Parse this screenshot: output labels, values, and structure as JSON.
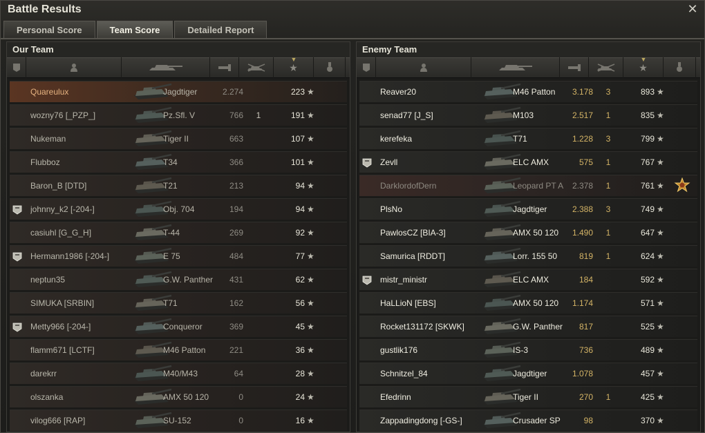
{
  "window": {
    "title": "Battle Results",
    "close_label": "✕"
  },
  "tabs": [
    {
      "label": "Personal Score",
      "active": false
    },
    {
      "label": "Team Score",
      "active": true
    },
    {
      "label": "Detailed Report",
      "active": false
    }
  ],
  "our_team": {
    "title": "Our Team",
    "rows": [
      {
        "name": "Quareulux",
        "tank": "Jagdtiger",
        "damage": "2.274",
        "frags": "",
        "xp": "223",
        "badge": false,
        "self": true
      },
      {
        "name": "wozny76 [_PZP_]",
        "tank": "Pz.Sfl. V",
        "damage": "766",
        "frags": "1",
        "xp": "191",
        "badge": false
      },
      {
        "name": "Nukeman",
        "tank": "Tiger II",
        "damage": "663",
        "frags": "",
        "xp": "107",
        "badge": false
      },
      {
        "name": "Flubboz",
        "tank": "T34",
        "damage": "366",
        "frags": "",
        "xp": "101",
        "badge": false
      },
      {
        "name": "Baron_B [DTD]",
        "tank": "T21",
        "damage": "213",
        "frags": "",
        "xp": "94",
        "badge": false
      },
      {
        "name": "johnny_k2 [-204-]",
        "tank": "Obj. 704",
        "damage": "194",
        "frags": "",
        "xp": "94",
        "badge": true
      },
      {
        "name": "casiuhl [G_G_H]",
        "tank": "T-44",
        "damage": "269",
        "frags": "",
        "xp": "92",
        "badge": false
      },
      {
        "name": "Hermann1986 [-204-]",
        "tank": "E 75",
        "damage": "484",
        "frags": "",
        "xp": "77",
        "badge": true
      },
      {
        "name": "neptun35",
        "tank": "G.W. Panther",
        "damage": "431",
        "frags": "",
        "xp": "62",
        "badge": false
      },
      {
        "name": "SIMUKA [SRBIN]",
        "tank": "T71",
        "damage": "162",
        "frags": "",
        "xp": "56",
        "badge": false
      },
      {
        "name": "Metty966 [-204-]",
        "tank": "Conqueror",
        "damage": "369",
        "frags": "",
        "xp": "45",
        "badge": true
      },
      {
        "name": "flamm671 [LCTF]",
        "tank": "M46 Patton",
        "damage": "221",
        "frags": "",
        "xp": "36",
        "badge": false
      },
      {
        "name": "darekrr",
        "tank": "M40/M43",
        "damage": "64",
        "frags": "",
        "xp": "28",
        "badge": false
      },
      {
        "name": "olszanka",
        "tank": "AMX 50 120",
        "damage": "0",
        "frags": "",
        "xp": "24",
        "badge": false
      },
      {
        "name": "vilog666 [RAP]",
        "tank": "SU-152",
        "damage": "0",
        "frags": "",
        "xp": "16",
        "badge": false
      }
    ]
  },
  "enemy_team": {
    "title": "Enemy Team",
    "rows": [
      {
        "name": "Reaver20",
        "tank": "M46 Patton",
        "damage": "3.178",
        "frags": "3",
        "xp": "893",
        "badge": false
      },
      {
        "name": "senad77 [J_S]",
        "tank": "M103",
        "damage": "2.517",
        "frags": "1",
        "xp": "835",
        "badge": false
      },
      {
        "name": "kerefeka",
        "tank": "T71",
        "damage": "1.228",
        "frags": "3",
        "xp": "799",
        "badge": false
      },
      {
        "name": "Zevll",
        "tank": "ELC AMX",
        "damage": "575",
        "frags": "1",
        "xp": "767",
        "badge": true
      },
      {
        "name": "DarklordofDern",
        "tank": "Leopard PT A",
        "damage": "2.378",
        "frags": "1",
        "xp": "761",
        "badge": false,
        "dead": true,
        "medal": true
      },
      {
        "name": "PlsNo",
        "tank": "Jagdtiger",
        "damage": "2.388",
        "frags": "3",
        "xp": "749",
        "badge": false
      },
      {
        "name": "PawlosCZ [BIA-3]",
        "tank": "AMX 50 120",
        "damage": "1.490",
        "frags": "1",
        "xp": "647",
        "badge": false
      },
      {
        "name": "Samurica [RDDT]",
        "tank": "Lorr. 155 50",
        "damage": "819",
        "frags": "1",
        "xp": "624",
        "badge": false
      },
      {
        "name": "mistr_ministr",
        "tank": "ELC AMX",
        "damage": "184",
        "frags": "",
        "xp": "592",
        "badge": true
      },
      {
        "name": "HaLLioN [EBS]",
        "tank": "AMX 50 120",
        "damage": "1.174",
        "frags": "",
        "xp": "571",
        "badge": false
      },
      {
        "name": "Rocket131172 [SKWK]",
        "tank": "G.W. Panther",
        "damage": "817",
        "frags": "",
        "xp": "525",
        "badge": false
      },
      {
        "name": "gustlik176",
        "tank": "IS-3",
        "damage": "736",
        "frags": "",
        "xp": "489",
        "badge": false
      },
      {
        "name": "Schnitzel_84",
        "tank": "Jagdtiger",
        "damage": "1.078",
        "frags": "",
        "xp": "457",
        "badge": false
      },
      {
        "name": "Efedrinn",
        "tank": "Tiger II",
        "damage": "270",
        "frags": "1",
        "xp": "425",
        "badge": false
      },
      {
        "name": "Zappadingdong [-GS-]",
        "tank": "Crusader SP",
        "damage": "98",
        "frags": "",
        "xp": "370",
        "badge": false
      }
    ]
  },
  "columns": [
    "squad-icon",
    "player-icon",
    "tank-icon",
    "damage-icon",
    "frags-icon",
    "xp-icon",
    "medal-icon"
  ],
  "colors": {
    "accent_gold": "#d4b466",
    "self_highlight": "#5a3522"
  }
}
